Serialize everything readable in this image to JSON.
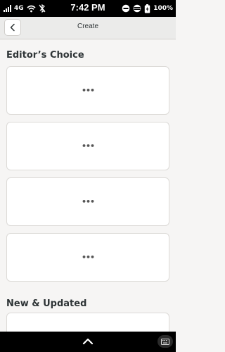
{
  "status_bar": {
    "network": "4G",
    "time": "7:42 PM",
    "battery": "100%"
  },
  "header": {
    "title": "Create",
    "back_icon": "chevron-left-icon"
  },
  "sections": [
    {
      "title": "Editor’s Choice",
      "cards": [
        "•••",
        "•••",
        "•••",
        "•••"
      ]
    },
    {
      "title": "New & Updated",
      "cards": [
        "•••"
      ]
    }
  ],
  "bottom_bar": {
    "handle_icon": "chevron-up-icon",
    "keyboard_icon": "keyboard-icon"
  }
}
